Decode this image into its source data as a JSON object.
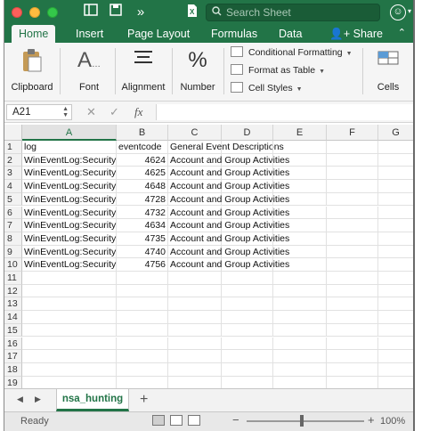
{
  "window": {
    "search_placeholder": "Search Sheet"
  },
  "tabs": [
    "Home",
    "Insert",
    "Page Layout",
    "Formulas",
    "Data"
  ],
  "share_label": "Share",
  "ribbon": {
    "clipboard": "Clipboard",
    "font": "Font",
    "alignment": "Alignment",
    "number": "Number",
    "conditional_formatting": "Conditional Formatting",
    "format_as_table": "Format as Table",
    "cell_styles": "Cell Styles",
    "cells": "Cells"
  },
  "formula_bar": {
    "name_box": "A21",
    "fx": "fx",
    "cancel": "✕",
    "confirm": "✓"
  },
  "columns": [
    "A",
    "B",
    "C",
    "D",
    "E",
    "F",
    "G"
  ],
  "row_numbers": [
    "1",
    "2",
    "3",
    "4",
    "5",
    "6",
    "7",
    "8",
    "9",
    "10",
    "11",
    "12",
    "13",
    "14",
    "15",
    "16",
    "17",
    "18",
    "19",
    "20"
  ],
  "rows": [
    [
      "log",
      "eventcode",
      "General Event Descriptions"
    ],
    [
      "WinEventLog:Security",
      "4624",
      "Account and Group Activities"
    ],
    [
      "WinEventLog:Security",
      "4625",
      "Account and Group Activities"
    ],
    [
      "WinEventLog:Security",
      "4648",
      "Account and Group Activities"
    ],
    [
      "WinEventLog:Security",
      "4728",
      "Account and Group Activities"
    ],
    [
      "WinEventLog:Security",
      "4732",
      "Account and Group Activities"
    ],
    [
      "WinEventLog:Security",
      "4634",
      "Account and Group Activities"
    ],
    [
      "WinEventLog:Security",
      "4735",
      "Account and Group Activities"
    ],
    [
      "WinEventLog:Security",
      "4740",
      "Account and Group Activities"
    ],
    [
      "WinEventLog:Security",
      "4756",
      "Account and Group Activities"
    ]
  ],
  "sheet_tab": "nsa_hunting",
  "status": {
    "text": "Ready",
    "zoom": "100%"
  },
  "colors": {
    "accent": "#227447"
  }
}
